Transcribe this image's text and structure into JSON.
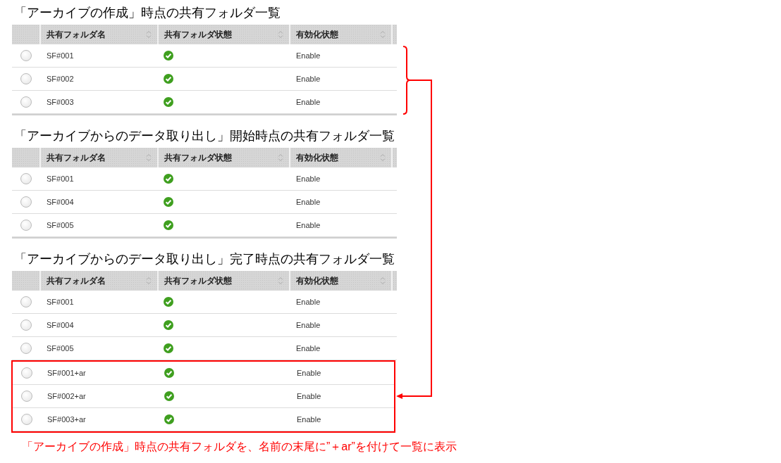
{
  "sections": [
    {
      "title": "「アーカイブの作成」時点の共有フォルダ一覧",
      "columns": [
        "共有フォルダ名",
        "共有フォルダ状態",
        "有効化状態"
      ],
      "rows": [
        {
          "selected": false,
          "name": "SF#001",
          "kind": "check",
          "enabled": "Enable",
          "highlighted": false
        },
        {
          "selected": false,
          "name": "SF#002",
          "kind": "check",
          "enabled": "Enable",
          "highlighted": false
        },
        {
          "selected": false,
          "name": "SF#003",
          "kind": "check",
          "enabled": "Enable",
          "highlighted": false
        }
      ]
    },
    {
      "title": "「アーカイブからのデータ取り出し」開始時点の共有フォルダ一覧",
      "columns": [
        "共有フォルダ名",
        "共有フォルダ状態",
        "有効化状態"
      ],
      "rows": [
        {
          "selected": false,
          "name": "SF#001",
          "kind": "check",
          "enabled": "Enable",
          "highlighted": false
        },
        {
          "selected": false,
          "name": "SF#004",
          "kind": "check",
          "enabled": "Enable",
          "highlighted": false
        },
        {
          "selected": false,
          "name": "SF#005",
          "kind": "check",
          "enabled": "Enable",
          "highlighted": false
        }
      ]
    },
    {
      "title": "「アーカイブからのデータ取り出し」完了時点の共有フォルダ一覧",
      "columns": [
        "共有フォルダ名",
        "共有フォルダ状態",
        "有効化状態"
      ],
      "rows": [
        {
          "selected": false,
          "name": "SF#001",
          "kind": "check",
          "enabled": "Enable",
          "highlighted": false
        },
        {
          "selected": false,
          "name": "SF#004",
          "kind": "check",
          "enabled": "Enable",
          "highlighted": false
        },
        {
          "selected": false,
          "name": "SF#005",
          "kind": "check",
          "enabled": "Enable",
          "highlighted": false
        },
        {
          "selected": false,
          "name": "SF#001+ar",
          "kind": "check",
          "enabled": "Enable",
          "highlighted": true
        },
        {
          "selected": false,
          "name": "SF#002+ar",
          "kind": "check",
          "enabled": "Enable",
          "highlighted": true
        },
        {
          "selected": false,
          "name": "SF#003+ar",
          "kind": "check",
          "enabled": "Enable",
          "highlighted": true
        }
      ]
    }
  ],
  "caption": "「アーカイブの作成」時点の共有フォルダを、名前の末尾に”＋ar”を付けて一覧に表示"
}
